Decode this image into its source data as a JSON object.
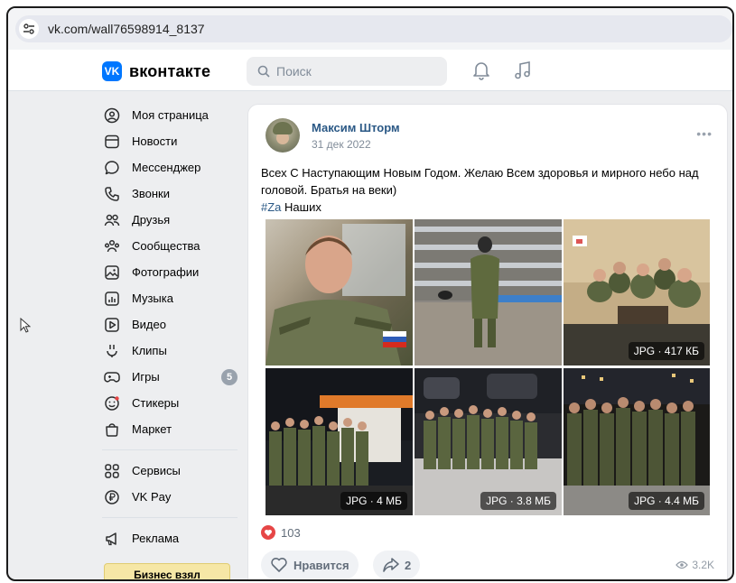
{
  "browser": {
    "url": "vk.com/wall76598914_8137"
  },
  "header": {
    "logo_mark": "VK",
    "logo_text": "вконтакте",
    "search_placeholder": "Поиск"
  },
  "nav": {
    "items": [
      {
        "label": "Моя страница",
        "icon": "user-circle-icon"
      },
      {
        "label": "Новости",
        "icon": "newspaper-icon"
      },
      {
        "label": "Мессенджер",
        "icon": "message-icon"
      },
      {
        "label": "Звонки",
        "icon": "phone-icon"
      },
      {
        "label": "Друзья",
        "icon": "friends-icon"
      },
      {
        "label": "Сообщества",
        "icon": "communities-icon"
      },
      {
        "label": "Фотографии",
        "icon": "photos-icon"
      },
      {
        "label": "Музыка",
        "icon": "music-icon"
      },
      {
        "label": "Видео",
        "icon": "video-icon"
      },
      {
        "label": "Клипы",
        "icon": "clips-icon"
      },
      {
        "label": "Игры",
        "icon": "games-icon",
        "badge": "5"
      },
      {
        "label": "Стикеры",
        "icon": "stickers-icon"
      },
      {
        "label": "Маркет",
        "icon": "market-icon"
      }
    ],
    "services": [
      {
        "label": "Сервисы",
        "icon": "services-icon"
      },
      {
        "label": "VK Pay",
        "icon": "vkpay-icon"
      }
    ],
    "ads": {
      "label": "Реклама",
      "icon": "megaphone-icon"
    },
    "promo": "Бизнес взял"
  },
  "post": {
    "author": "Максим Шторм",
    "date": "31 дек 2022",
    "text": "Всех С Наступающим Новым Годом. Желаю Всем здоровья и мирного небо над головой. Братья на веки)",
    "hashtag": "#Za",
    "hashtag_tail": " Наших",
    "photos": [
      {
        "badge": ""
      },
      {
        "badge": ""
      },
      {
        "badge": "JPG · 417 КБ"
      },
      {
        "badge": "JPG · 4 МБ"
      },
      {
        "badge": "JPG · 3.8 МБ"
      },
      {
        "badge": "JPG · 4.4 МБ"
      }
    ],
    "likes": "103",
    "like_button": "Нравится",
    "shares": "2",
    "views": "3.2K"
  },
  "colors": {
    "accent": "#0077ff",
    "link": "#2a5885",
    "like_red": "#e64646"
  }
}
